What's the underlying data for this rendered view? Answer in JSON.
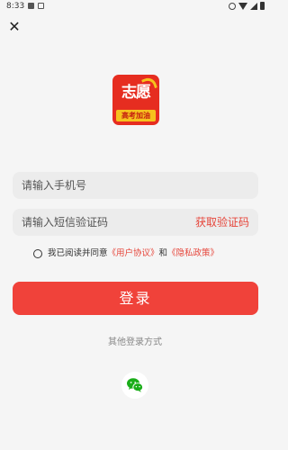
{
  "status_bar": {
    "time": "8:33"
  },
  "logo": {
    "main_text": "志愿",
    "sub_text": "高考加油"
  },
  "form": {
    "phone_placeholder": "请输入手机号",
    "code_placeholder": "请输入短信验证码",
    "get_code_label": "获取验证码"
  },
  "agreement": {
    "prefix": "我已阅读并同意",
    "user_agreement": "《用户协议》",
    "and": "和",
    "privacy_policy": "《隐私政策》"
  },
  "login_label": "登录",
  "other_methods_label": "其他登录方式",
  "colors": {
    "accent": "#f0423a",
    "link": "#e6453a",
    "wechat": "#1aad19"
  },
  "icons": [
    "close-icon",
    "wechat-icon",
    "wifi-icon",
    "signal-icon",
    "battery-icon"
  ]
}
